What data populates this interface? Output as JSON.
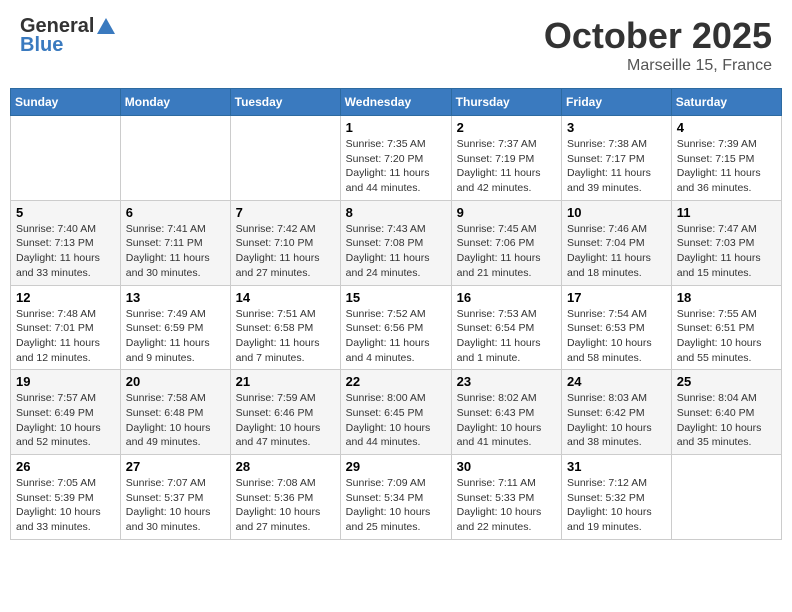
{
  "header": {
    "logo_general": "General",
    "logo_blue": "Blue",
    "month": "October 2025",
    "location": "Marseille 15, France"
  },
  "weekdays": [
    "Sunday",
    "Monday",
    "Tuesday",
    "Wednesday",
    "Thursday",
    "Friday",
    "Saturday"
  ],
  "weeks": [
    [
      {
        "day": "",
        "info": ""
      },
      {
        "day": "",
        "info": ""
      },
      {
        "day": "",
        "info": ""
      },
      {
        "day": "1",
        "info": "Sunrise: 7:35 AM\nSunset: 7:20 PM\nDaylight: 11 hours and 44 minutes."
      },
      {
        "day": "2",
        "info": "Sunrise: 7:37 AM\nSunset: 7:19 PM\nDaylight: 11 hours and 42 minutes."
      },
      {
        "day": "3",
        "info": "Sunrise: 7:38 AM\nSunset: 7:17 PM\nDaylight: 11 hours and 39 minutes."
      },
      {
        "day": "4",
        "info": "Sunrise: 7:39 AM\nSunset: 7:15 PM\nDaylight: 11 hours and 36 minutes."
      }
    ],
    [
      {
        "day": "5",
        "info": "Sunrise: 7:40 AM\nSunset: 7:13 PM\nDaylight: 11 hours and 33 minutes."
      },
      {
        "day": "6",
        "info": "Sunrise: 7:41 AM\nSunset: 7:11 PM\nDaylight: 11 hours and 30 minutes."
      },
      {
        "day": "7",
        "info": "Sunrise: 7:42 AM\nSunset: 7:10 PM\nDaylight: 11 hours and 27 minutes."
      },
      {
        "day": "8",
        "info": "Sunrise: 7:43 AM\nSunset: 7:08 PM\nDaylight: 11 hours and 24 minutes."
      },
      {
        "day": "9",
        "info": "Sunrise: 7:45 AM\nSunset: 7:06 PM\nDaylight: 11 hours and 21 minutes."
      },
      {
        "day": "10",
        "info": "Sunrise: 7:46 AM\nSunset: 7:04 PM\nDaylight: 11 hours and 18 minutes."
      },
      {
        "day": "11",
        "info": "Sunrise: 7:47 AM\nSunset: 7:03 PM\nDaylight: 11 hours and 15 minutes."
      }
    ],
    [
      {
        "day": "12",
        "info": "Sunrise: 7:48 AM\nSunset: 7:01 PM\nDaylight: 11 hours and 12 minutes."
      },
      {
        "day": "13",
        "info": "Sunrise: 7:49 AM\nSunset: 6:59 PM\nDaylight: 11 hours and 9 minutes."
      },
      {
        "day": "14",
        "info": "Sunrise: 7:51 AM\nSunset: 6:58 PM\nDaylight: 11 hours and 7 minutes."
      },
      {
        "day": "15",
        "info": "Sunrise: 7:52 AM\nSunset: 6:56 PM\nDaylight: 11 hours and 4 minutes."
      },
      {
        "day": "16",
        "info": "Sunrise: 7:53 AM\nSunset: 6:54 PM\nDaylight: 11 hours and 1 minute."
      },
      {
        "day": "17",
        "info": "Sunrise: 7:54 AM\nSunset: 6:53 PM\nDaylight: 10 hours and 58 minutes."
      },
      {
        "day": "18",
        "info": "Sunrise: 7:55 AM\nSunset: 6:51 PM\nDaylight: 10 hours and 55 minutes."
      }
    ],
    [
      {
        "day": "19",
        "info": "Sunrise: 7:57 AM\nSunset: 6:49 PM\nDaylight: 10 hours and 52 minutes."
      },
      {
        "day": "20",
        "info": "Sunrise: 7:58 AM\nSunset: 6:48 PM\nDaylight: 10 hours and 49 minutes."
      },
      {
        "day": "21",
        "info": "Sunrise: 7:59 AM\nSunset: 6:46 PM\nDaylight: 10 hours and 47 minutes."
      },
      {
        "day": "22",
        "info": "Sunrise: 8:00 AM\nSunset: 6:45 PM\nDaylight: 10 hours and 44 minutes."
      },
      {
        "day": "23",
        "info": "Sunrise: 8:02 AM\nSunset: 6:43 PM\nDaylight: 10 hours and 41 minutes."
      },
      {
        "day": "24",
        "info": "Sunrise: 8:03 AM\nSunset: 6:42 PM\nDaylight: 10 hours and 38 minutes."
      },
      {
        "day": "25",
        "info": "Sunrise: 8:04 AM\nSunset: 6:40 PM\nDaylight: 10 hours and 35 minutes."
      }
    ],
    [
      {
        "day": "26",
        "info": "Sunrise: 7:05 AM\nSunset: 5:39 PM\nDaylight: 10 hours and 33 minutes."
      },
      {
        "day": "27",
        "info": "Sunrise: 7:07 AM\nSunset: 5:37 PM\nDaylight: 10 hours and 30 minutes."
      },
      {
        "day": "28",
        "info": "Sunrise: 7:08 AM\nSunset: 5:36 PM\nDaylight: 10 hours and 27 minutes."
      },
      {
        "day": "29",
        "info": "Sunrise: 7:09 AM\nSunset: 5:34 PM\nDaylight: 10 hours and 25 minutes."
      },
      {
        "day": "30",
        "info": "Sunrise: 7:11 AM\nSunset: 5:33 PM\nDaylight: 10 hours and 22 minutes."
      },
      {
        "day": "31",
        "info": "Sunrise: 7:12 AM\nSunset: 5:32 PM\nDaylight: 10 hours and 19 minutes."
      },
      {
        "day": "",
        "info": ""
      }
    ]
  ]
}
